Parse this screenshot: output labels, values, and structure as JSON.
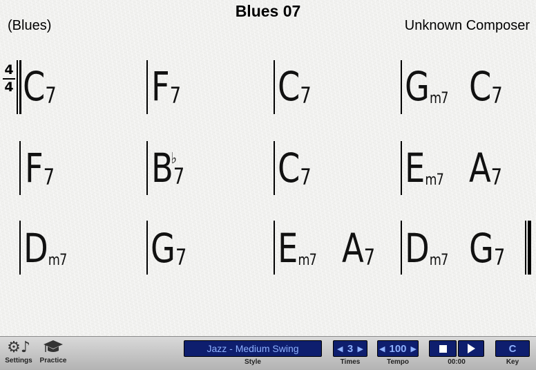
{
  "song": {
    "title": "Blues 07",
    "style": "(Blues)",
    "composer": "Unknown Composer",
    "time_signature": {
      "top": "4",
      "bottom": "4"
    }
  },
  "chords": [
    {
      "root": "C",
      "quality": "7"
    },
    {
      "root": "F",
      "quality": "7"
    },
    {
      "root": "C",
      "quality": "7"
    },
    {
      "root": "G",
      "quality": "m7"
    },
    {
      "root": "C",
      "quality": "7"
    },
    {
      "root": "F",
      "quality": "7"
    },
    {
      "root": "B",
      "accidental": "♭",
      "quality": "7"
    },
    {
      "root": "C",
      "quality": "7"
    },
    {
      "root": "E",
      "quality": "m7"
    },
    {
      "root": "A",
      "quality": "7"
    },
    {
      "root": "D",
      "quality": "m7"
    },
    {
      "root": "G",
      "quality": "7"
    },
    {
      "root": "E",
      "quality": "m7"
    },
    {
      "root": "A",
      "quality": "7"
    },
    {
      "root": "D",
      "quality": "m7"
    },
    {
      "root": "G",
      "quality": "7"
    }
  ],
  "toolbar": {
    "settings_label": "Settings",
    "settings_icon": "gear-music-icon",
    "practice_label": "Practice",
    "practice_icon": "graduation-cap-icon",
    "style_value": "Jazz - Medium Swing",
    "style_label": "Style",
    "times_value": "3",
    "times_label": "Times",
    "tempo_value": "100",
    "tempo_label": "Tempo",
    "time_elapsed": "00:00",
    "key_value": "C",
    "key_label": "Key"
  },
  "colors": {
    "panel_bg": "#0e1e6e",
    "panel_text": "#8fb2ff"
  }
}
